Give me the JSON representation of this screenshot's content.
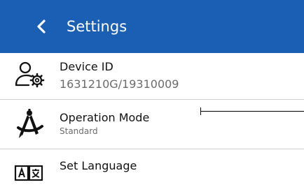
{
  "header": {
    "title": "Settings",
    "back_icon": "chevron-left-icon",
    "background_color": "#1a5fb4"
  },
  "settings": {
    "items": [
      {
        "label": "Device ID",
        "value": "1631210G/19310009",
        "icon": "user-gear-icon"
      },
      {
        "label": "Operation Mode",
        "value": "Standard",
        "icon": "drafting-compass-icon"
      },
      {
        "label": "Set Language",
        "icon": "language-icon"
      }
    ]
  }
}
